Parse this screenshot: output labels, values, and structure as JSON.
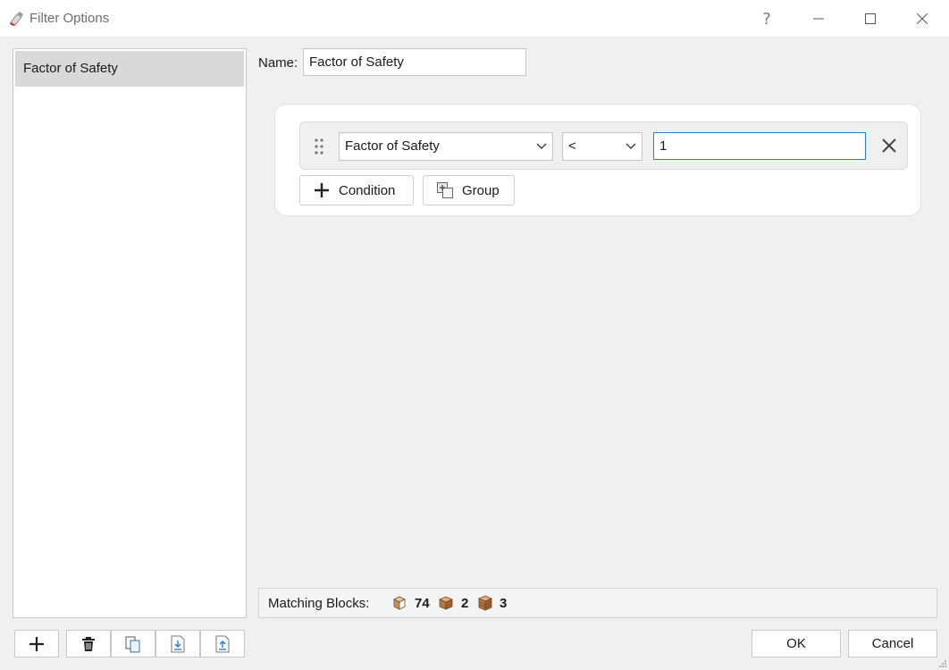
{
  "window": {
    "title": "Filter Options",
    "controls": [
      "help-icon",
      "minimize-icon",
      "maximize-icon",
      "close-icon"
    ],
    "help_glyph": "?"
  },
  "filters_list": {
    "items": [
      {
        "label": "Factor of Safety",
        "selected": true
      }
    ]
  },
  "name_field": {
    "label": "Name:",
    "value": "Factor of Safety"
  },
  "condition": {
    "field": "Factor of Safety",
    "operator": "<",
    "value": "1"
  },
  "actions": {
    "condition_label": "Condition",
    "group_label": "Group"
  },
  "matching": {
    "label": "Matching Blocks:",
    "counts": [
      {
        "icon": "block-type-1-icon",
        "count": "74"
      },
      {
        "icon": "block-type-2-icon",
        "count": "2"
      },
      {
        "icon": "block-type-3-icon",
        "count": "3"
      }
    ]
  },
  "bottom_toolbar": [
    "add-icon",
    "delete-icon",
    "copy-icon",
    "import-icon",
    "export-icon"
  ],
  "dialog_buttons": {
    "ok": "OK",
    "cancel": "Cancel"
  },
  "colors": {
    "accent": "#2a7bd4",
    "selected_item": "#d9d9d9",
    "block_tan": "#c8915a"
  }
}
